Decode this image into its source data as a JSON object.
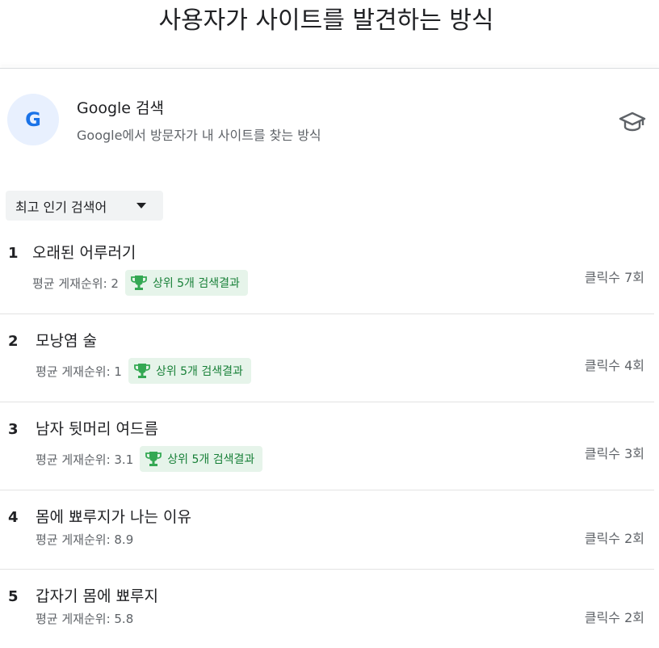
{
  "page_title": "사용자가 사이트를 발견하는 방식",
  "source": {
    "avatar_letter": "G",
    "title": "Google 검색",
    "subtitle": "Google에서 방문자가 내 사이트를 찾는 방식",
    "learn_icon": "school-icon"
  },
  "dropdown": {
    "label": "최고 인기 검색어"
  },
  "colors": {
    "chip_bg": "#e6f4ea",
    "chip_text": "#188038",
    "avatar_bg": "#e8f0fe",
    "avatar_text": "#1a73e8"
  },
  "queries": [
    {
      "rank": "1",
      "query": "오래된 어루러기",
      "position": "평균 게재순위: 2",
      "badge": "상위 5개 검색결과",
      "clicks": "클릭수 7회"
    },
    {
      "rank": "2",
      "query": "모낭염 술",
      "position": "평균 게재순위: 1",
      "badge": "상위 5개 검색결과",
      "clicks": "클릭수 4회"
    },
    {
      "rank": "3",
      "query": "남자 뒷머리 여드름",
      "position": "평균 게재순위: 3.1",
      "badge": "상위 5개 검색결과",
      "clicks": "클릭수 3회"
    },
    {
      "rank": "4",
      "query": "몸에 뾰루지가 나는 이유",
      "position": "평균 게재순위: 8.9",
      "clicks": "클릭수 2회"
    },
    {
      "rank": "5",
      "query": "갑자기 몸에 뾰루지",
      "position": "평균 게재순위: 5.8",
      "clicks": "클릭수 2회"
    }
  ]
}
